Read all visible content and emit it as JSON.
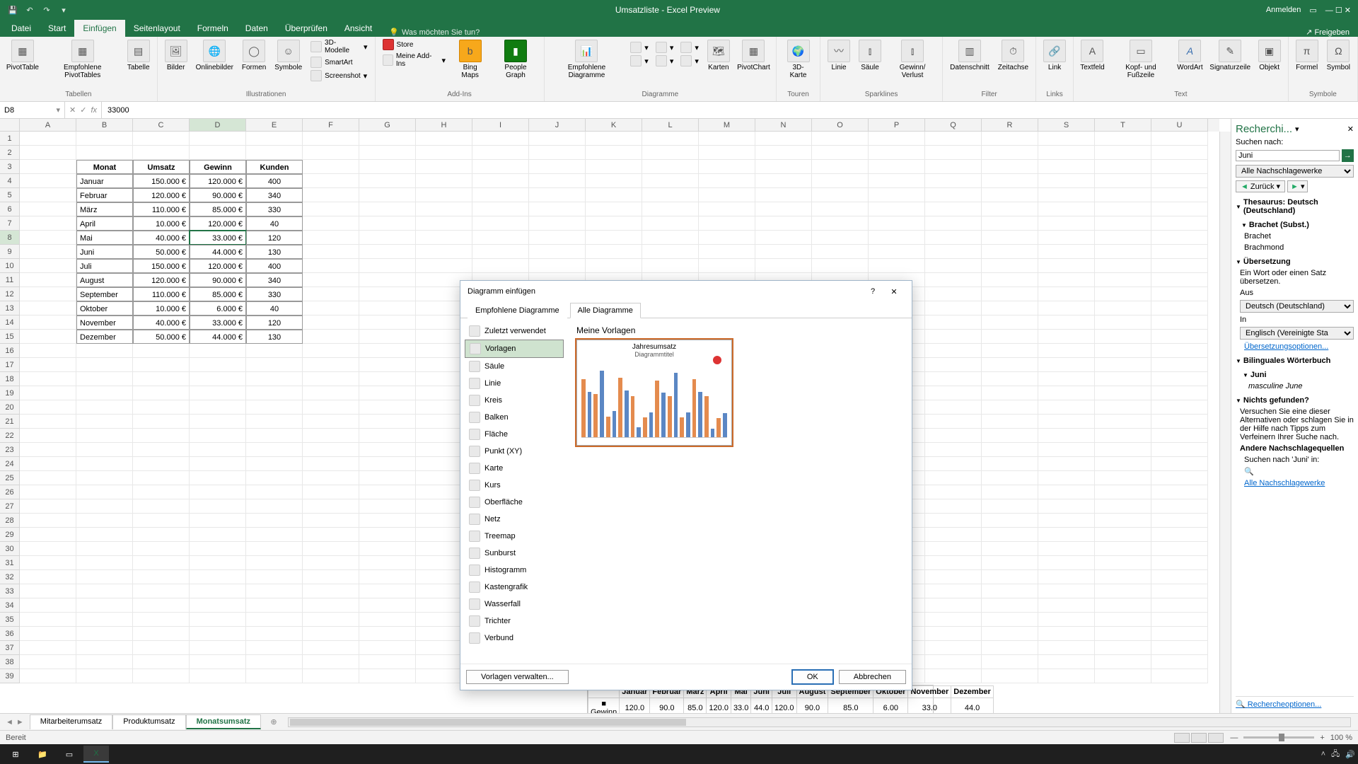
{
  "titlebar": {
    "title": "Umsatzliste - Excel Preview",
    "signIn": "Anmelden"
  },
  "ribbonTabs": {
    "tabs": [
      "Datei",
      "Start",
      "Einfügen",
      "Seitenlayout",
      "Formeln",
      "Daten",
      "Überprüfen",
      "Ansicht"
    ],
    "activeIndex": 2,
    "tellMe": "Was möchten Sie tun?",
    "share": "Freigeben"
  },
  "ribbon": {
    "groups": {
      "tabellen": {
        "label": "Tabellen",
        "pivotTable": "PivotTable",
        "recommendedPivot": "Empfohlene\nPivotTables",
        "table": "Tabelle"
      },
      "illustrationen": {
        "label": "Illustrationen",
        "pictures": "Bilder",
        "onlinePictures": "Onlinebilder",
        "shapes": "Formen",
        "icons": "Symbole",
        "models3d": "3D-Modelle",
        "smartart": "SmartArt",
        "screenshot": "Screenshot"
      },
      "addins": {
        "label": "Add-Ins",
        "store": "Store",
        "myAddins": "Meine Add-Ins",
        "bingMaps": "Bing\nMaps",
        "peopleGraph": "People\nGraph"
      },
      "diagramme": {
        "label": "Diagramme",
        "recommended": "Empfohlene\nDiagramme",
        "maps": "Karten",
        "pivotChart": "PivotChart"
      },
      "touren": {
        "label": "Touren",
        "map3d": "3D-\nKarte"
      },
      "sparklines": {
        "label": "Sparklines",
        "line": "Linie",
        "column": "Säule",
        "winLoss": "Gewinn/\nVerlust"
      },
      "filter": {
        "label": "Filter",
        "slicer": "Datenschnitt",
        "timeline": "Zeitachse"
      },
      "links": {
        "label": "Links",
        "link": "Link"
      },
      "text": {
        "label": "Text",
        "textbox": "Textfeld",
        "headerFooter": "Kopf- und\nFußzeile",
        "wordart": "WordArt",
        "signature": "Signaturzeile",
        "object": "Objekt"
      },
      "symbole": {
        "label": "Symbole",
        "equation": "Formel",
        "symbol": "Symbol"
      }
    }
  },
  "formulaBar": {
    "nameBox": "D8",
    "value": "33000"
  },
  "columns": [
    "A",
    "B",
    "C",
    "D",
    "E",
    "F",
    "G",
    "H",
    "I",
    "J",
    "K",
    "L",
    "M",
    "N",
    "O",
    "P",
    "Q",
    "R",
    "S",
    "T",
    "U"
  ],
  "table": {
    "headers": [
      "Monat",
      "Umsatz",
      "Gewinn",
      "Kunden"
    ],
    "rows": [
      [
        "Januar",
        "150.000 €",
        "120.000 €",
        "400"
      ],
      [
        "Februar",
        "120.000 €",
        "90.000 €",
        "340"
      ],
      [
        "März",
        "110.000 €",
        "85.000 €",
        "330"
      ],
      [
        "April",
        "10.000 €",
        "120.000 €",
        "40"
      ],
      [
        "Mai",
        "40.000 €",
        "33.000 €",
        "120"
      ],
      [
        "Juni",
        "50.000 €",
        "44.000 €",
        "130"
      ],
      [
        "Juli",
        "150.000 €",
        "120.000 €",
        "400"
      ],
      [
        "August",
        "120.000 €",
        "90.000 €",
        "340"
      ],
      [
        "September",
        "110.000 €",
        "85.000 €",
        "330"
      ],
      [
        "Oktober",
        "10.000 €",
        "6.000 €",
        "40"
      ],
      [
        "November",
        "40.000 €",
        "33.000 €",
        "120"
      ],
      [
        "Dezember",
        "50.000 €",
        "44.000 €",
        "130"
      ]
    ]
  },
  "chartPeek": {
    "months": [
      "Januar",
      "Februar",
      "März",
      "April",
      "Mai",
      "Juni",
      "Juli",
      "August",
      "September",
      "Oktober",
      "November",
      "Dezember"
    ],
    "series": "Gewinn",
    "values": [
      "120.0",
      "90.0",
      "85.0",
      "120.0",
      "33.0",
      "44.0",
      "120.0",
      "90.0",
      "85.0",
      "6.00",
      "33.0",
      "44.0"
    ]
  },
  "dialog": {
    "title": "Diagramm einfügen",
    "tabRecommended": "Empfohlene Diagramme",
    "tabAll": "Alle Diagramme",
    "categories": [
      "Zuletzt verwendet",
      "Vorlagen",
      "Säule",
      "Linie",
      "Kreis",
      "Balken",
      "Fläche",
      "Punkt (XY)",
      "Karte",
      "Kurs",
      "Oberfläche",
      "Netz",
      "Treemap",
      "Sunburst",
      "Histogramm",
      "Kastengrafik",
      "Wasserfall",
      "Trichter",
      "Verbund"
    ],
    "selectedCategory": 1,
    "previewTitle": "Meine Vorlagen",
    "templateName": "Jahresumsatz",
    "templateSub": "Diagrammtitel",
    "manage": "Vorlagen verwalten...",
    "ok": "OK",
    "cancel": "Abbrechen"
  },
  "sheetTabs": {
    "tabs": [
      "Mitarbeiterumsatz",
      "Produktumsatz",
      "Monatsumsatz"
    ],
    "activeIndex": 2
  },
  "status": {
    "ready": "Bereit",
    "zoom": "100 %"
  },
  "research": {
    "title": "Recherchi...",
    "searchFor": "Suchen nach:",
    "searchValue": "Juni",
    "allRef": "Alle Nachschlagewerke",
    "back": "Zurück",
    "thesaurus": "Thesaurus: Deutsch (Deutschland)",
    "brachet": "Brachet (Subst.)",
    "brachet1": "Brachet",
    "brachet2": "Brachmond",
    "translation": "Übersetzung",
    "translationNote": "Ein Wort oder einen Satz übersetzen.",
    "from": "Aus",
    "fromLang": "Deutsch (Deutschland)",
    "to": "In",
    "toLang": "Englisch (Vereinigte Sta",
    "options": "Übersetzungsoptionen...",
    "bilingual": "Bilinguales Wörterbuch",
    "juni": "Juni",
    "juniDesc": "masculine June",
    "notFound": "Nichts gefunden?",
    "notFoundText": "Versuchen Sie eine dieser Alternativen oder schlagen Sie in der Hilfe nach Tipps zum Verfeinern Ihrer Suche nach.",
    "other": "Andere Nachschlagequellen",
    "otherText": "Suchen nach 'Juni' in:",
    "allRef2": "Alle Nachschlagewerke",
    "researchOptions": "Rechercheoptionen..."
  },
  "taskbar": {
    "time": ""
  }
}
